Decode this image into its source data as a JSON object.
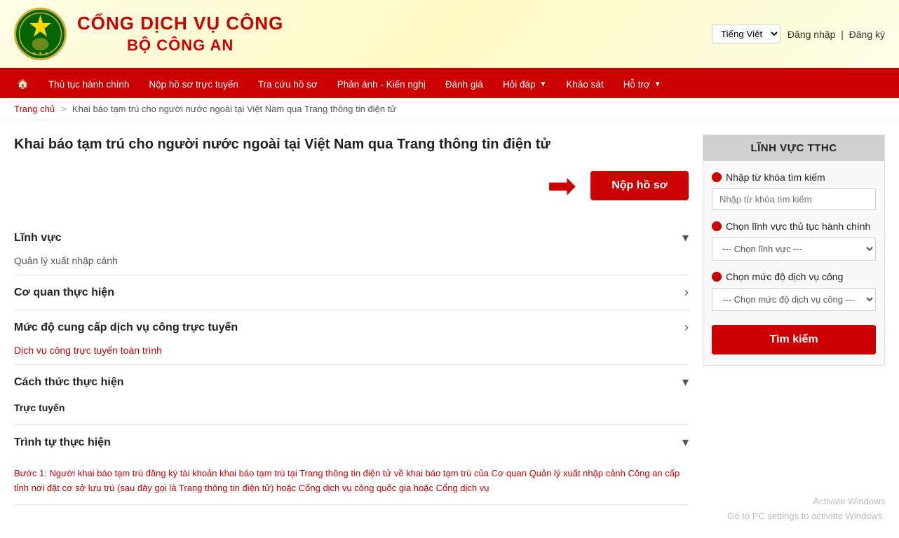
{
  "header": {
    "title_line1": "CỔNG DỊCH VỤ CÔNG",
    "title_line2": "BỘ CÔNG AN",
    "lang_selected": "Tiếng Việt",
    "login_label": "Đăng nhập",
    "register_label": "Đăng ký"
  },
  "navbar": {
    "home_icon": "🏠",
    "items": [
      {
        "label": "Thủ tục hành chính",
        "has_arrow": false
      },
      {
        "label": "Nộp hồ sơ trực tuyến",
        "has_arrow": false
      },
      {
        "label": "Tra cứu hồ sơ",
        "has_arrow": false
      },
      {
        "label": "Phản ánh - Kiến nghị",
        "has_arrow": false
      },
      {
        "label": "Đánh giá",
        "has_arrow": false
      },
      {
        "label": "Hỏi đáp",
        "has_arrow": true
      },
      {
        "label": "Khảo sát",
        "has_arrow": false
      },
      {
        "label": "Hỗ trợ",
        "has_arrow": true
      }
    ]
  },
  "breadcrumb": {
    "home": "Trang chủ",
    "sep": ">",
    "current": "Khai báo tạm trú cho người nước ngoài tại Việt Nam qua Trang thông tin điện tử"
  },
  "page": {
    "title": "Khai báo tạm trú cho người nước ngoài tại Việt Nam qua Trang thông tin điện tử",
    "submit_button": "Nộp hồ sơ"
  },
  "accordion": [
    {
      "id": "linh-vuc",
      "title": "Lĩnh vực",
      "icon": "chevron-down",
      "expanded": true,
      "content": "Quản lý xuất nhập cảnh",
      "is_link": false
    },
    {
      "id": "co-quan",
      "title": "Cơ quan thực hiện",
      "icon": "chevron-right",
      "expanded": false,
      "content": "",
      "is_link": false
    },
    {
      "id": "muc-do",
      "title": "Mức độ cung cấp dịch vụ công trực tuyến",
      "icon": "chevron-right",
      "expanded": true,
      "content": "Dịch vụ công trực tuyến toàn trình",
      "is_link": true
    },
    {
      "id": "cach-thuc",
      "title": "Cách thức thực hiện",
      "icon": "chevron-down",
      "expanded": true,
      "content_bold": "Trực tuyến",
      "content": ""
    },
    {
      "id": "trinh-tu",
      "title": "Trình tự thực hiện",
      "icon": "chevron-down",
      "expanded": false,
      "content": ""
    }
  ],
  "step_text": "Bước 1: Người khai báo tạm trú đăng ký tài khoản khai báo tạm trú tại Trang thông tin điện tử về khai báo tạm trú của Cơ quan Quản lý xuất nhập cảnh Công an cấp tỉnh nơi đặt cơ sở lưu trú (sau đây gọi là Trang thông tin điện tử) hoặc Cổng dịch vụ công quốc gia hoặc Cổng dịch vụ",
  "sidebar": {
    "title": "LĨNH VỰC TTHC",
    "search_label": "Nhập từ khóa tìm kiếm",
    "search_placeholder": "Nhập từ khóa tìm kiếm",
    "domain_label": "Chọn lĩnh vực thủ tục hành chính",
    "domain_default": "--- Chọn lĩnh vực ---",
    "domain_options": [
      "--- Chọn lĩnh vực ---"
    ],
    "level_label": "Chọn mức độ dịch vụ công",
    "level_default": "--- Chọn mức độ dịch vụ công ---",
    "level_options": [
      "--- Chọn mức độ dịch vụ công ---"
    ],
    "search_button": "Tìm kiếm"
  },
  "windows_activate": {
    "line1": "Activate Windows",
    "line2": "Go to PC settings to activate Windows."
  }
}
